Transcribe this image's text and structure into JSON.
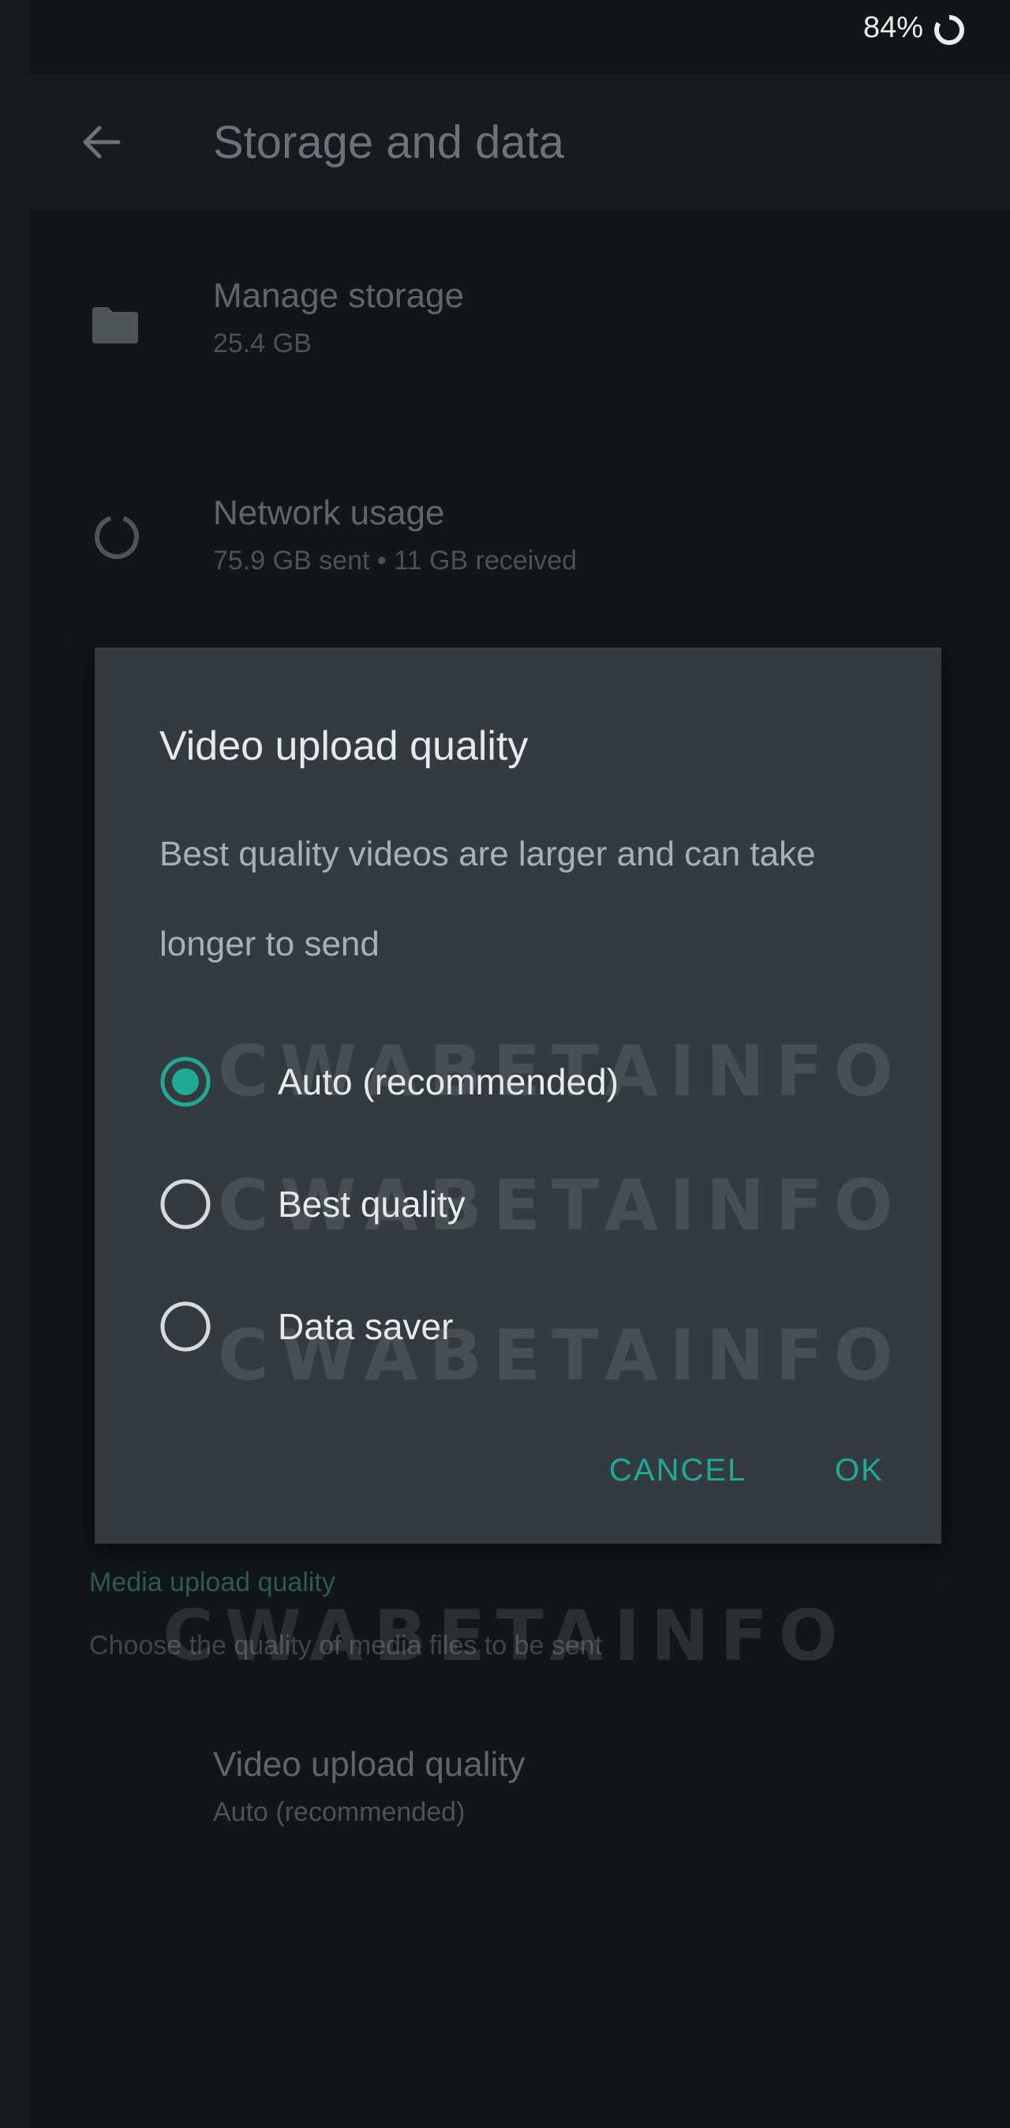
{
  "status_bar": {
    "battery": "84%"
  },
  "app_bar": {
    "title": "Storage and data",
    "back_icon": "arrow-back-icon"
  },
  "settings": {
    "manage_storage": {
      "title": "Manage storage",
      "subtitle": "25.4 GB",
      "icon": "folder-icon"
    },
    "network_usage": {
      "title": "Network usage",
      "subtitle": "75.9 GB sent • 11 GB received",
      "icon": "data-usage-icon"
    },
    "media_section": {
      "header": "Media upload quality",
      "subheader": "Choose the quality of media files to be sent"
    },
    "video_upload_quality": {
      "title": "Video upload quality",
      "subtitle": "Auto (recommended)"
    }
  },
  "dialog": {
    "title": "Video upload quality",
    "description": "Best quality videos are larger and can take longer to send",
    "options": [
      {
        "label": "Auto (recommended)",
        "selected": true
      },
      {
        "label": "Best quality",
        "selected": false
      },
      {
        "label": "Data saver",
        "selected": false
      }
    ],
    "cancel_label": "CANCEL",
    "ok_label": "OK"
  },
  "watermark": {
    "text": "CWABETAINFO"
  },
  "colors": {
    "accent": "#1faa93",
    "dialog_bg": "#343b40",
    "screen_bg": "#111619"
  }
}
